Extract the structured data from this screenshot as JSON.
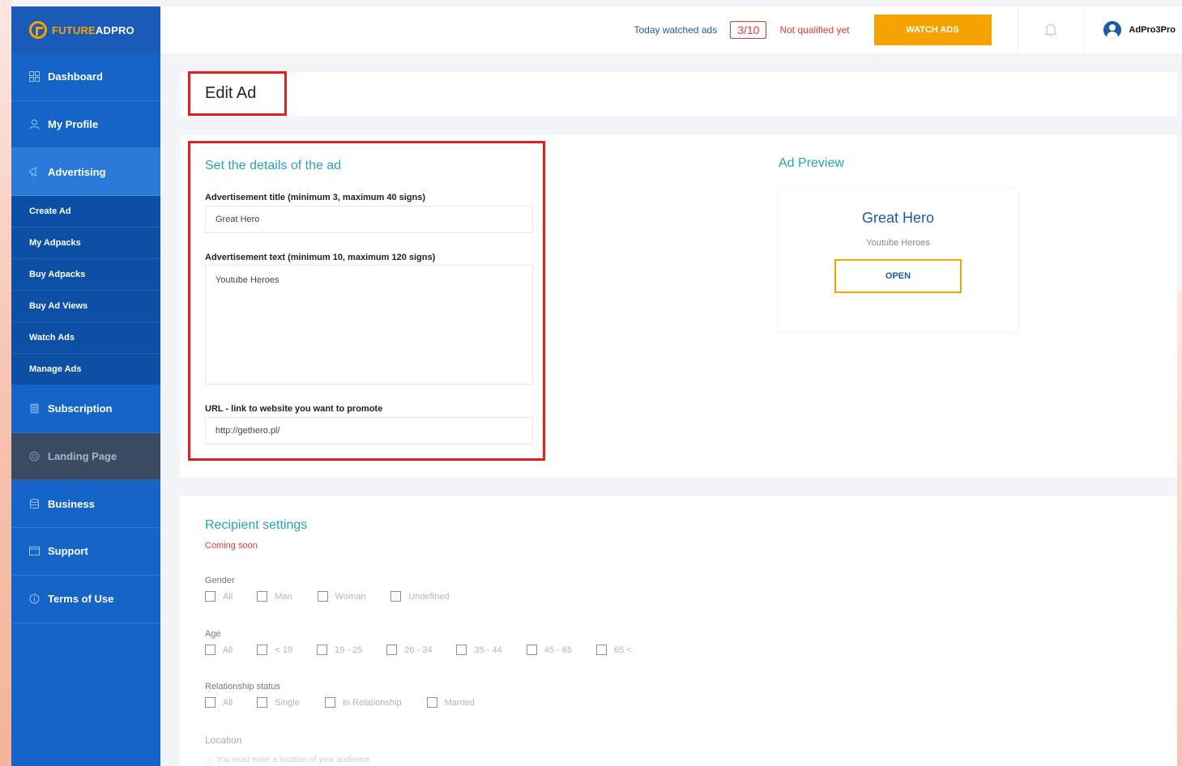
{
  "brand": {
    "part1": "FUTURE",
    "part2": "ADPRO"
  },
  "topbar": {
    "watched_label": "Today watched ads",
    "watched_count": "3/10",
    "status": "Not qualified yet",
    "watch_button": "WATCH ADS",
    "username": "AdPro3Pro"
  },
  "sidebar": {
    "dashboard": "Dashboard",
    "my_profile": "My Profile",
    "advertising": "Advertising",
    "sub": [
      "Create Ad",
      "My Adpacks",
      "Buy Adpacks",
      "Buy Ad Views",
      "Watch Ads",
      "Manage Ads"
    ],
    "subscription": "Subscription",
    "landing_page": "Landing Page",
    "business": "Business",
    "support": "Support",
    "terms": "Terms of Use"
  },
  "page": {
    "title": "Edit Ad"
  },
  "details": {
    "section_title": "Set the details of the ad",
    "title_label": "Advertisement title (minimum 3, maximum 40 signs)",
    "title_value": "Great Hero",
    "text_label": "Advertisement text (minimum 10, maximum 120 signs)",
    "text_value": "Youtube Heroes",
    "url_label": "URL - link to website you want to promote",
    "url_value": "http://gethero.pl/"
  },
  "preview": {
    "section_title": "Ad Preview",
    "title": "Great Hero",
    "text": "Youtube Heroes",
    "button": "OPEN"
  },
  "recipients": {
    "section_title": "Recipient settings",
    "coming_soon": "Coming soon",
    "gender_label": "Gender",
    "gender_options": [
      "All",
      "Man",
      "Woman",
      "Undefined"
    ],
    "age_label": "Age",
    "age_options": [
      "All",
      "< 19",
      "19 - 25",
      "26 - 34",
      "35 - 44",
      "45 - 65",
      "65 <"
    ],
    "relationship_label": "Relationship status",
    "relationship_options": [
      "All",
      "Single",
      "In Relationship",
      "Married"
    ],
    "location_label": "Location",
    "location_hint": "You must enter a location of your audience"
  },
  "colors": {
    "sidebar": "#1565c9",
    "accent": "#f4a300",
    "teal": "#25a3b8",
    "alert": "#e53935"
  }
}
